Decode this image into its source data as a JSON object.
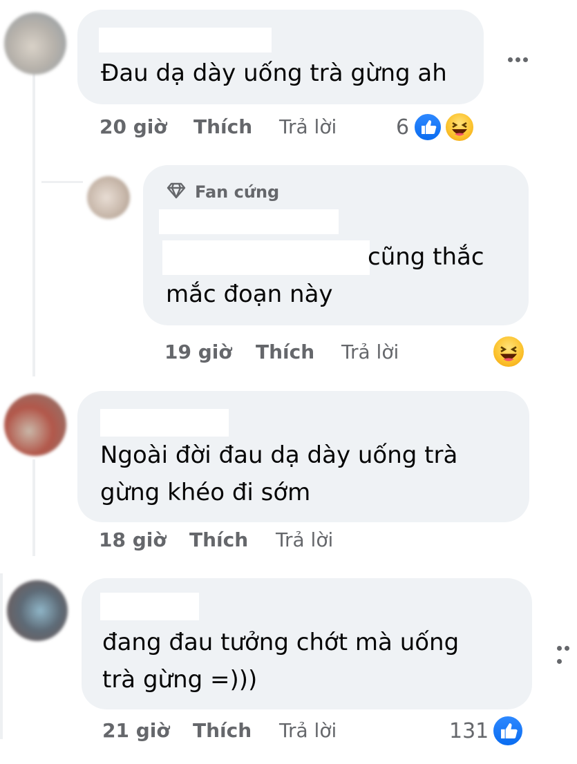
{
  "comments": [
    {
      "text_lines": [
        "Đau dạ dày uống trà gừng ah"
      ],
      "time": "20 giờ",
      "like_label": "Thích",
      "reply_label": "Trả lời",
      "reaction_count": "6",
      "reactions": [
        "like-icon",
        "haha-icon"
      ]
    },
    {
      "badge": "Fan cứng",
      "text_lines": [
        "cũng thắc",
        "mắc đoạn này"
      ],
      "time": "19 giờ",
      "like_label": "Thích",
      "reply_label": "Trả lời",
      "reactions": [
        "haha-icon"
      ]
    },
    {
      "text_lines": [
        "Ngoài đời đau dạ dày uống trà",
        "gừng khéo đi sớm"
      ],
      "time": "18 giờ",
      "like_label": "Thích",
      "reply_label": "Trả lời"
    },
    {
      "text_lines": [
        "đang đau tưởng chớt mà uống",
        "trà gừng =)))"
      ],
      "time": "21 giờ",
      "like_label": "Thích",
      "reply_label": "Trả lời",
      "reaction_count": "131",
      "reactions": [
        "like-icon"
      ]
    }
  ],
  "colors": {
    "bubble": "#eff2f5",
    "meta_text": "#65676b",
    "like_blue": "#1877f2",
    "haha_yellow": "#fcc430"
  }
}
